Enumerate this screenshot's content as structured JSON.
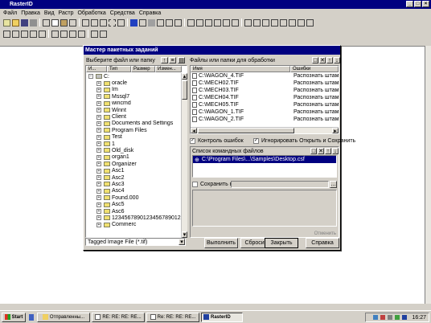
{
  "app": {
    "title": "RasterID",
    "menu": [
      "Файл",
      "Правка",
      "Вид",
      "Растр",
      "Обработка",
      "Средства",
      "Справка"
    ]
  },
  "dialog": {
    "title": "Мастер пакетных заданий",
    "left_panel": {
      "caption": "Выберите файл или папку",
      "columns": [
        "И...",
        "Тип",
        "Размер",
        "Измен..."
      ],
      "tree": [
        "C:",
        "oracle",
        "Im",
        "Mssql7",
        "wincmd",
        "Winnt",
        "Client",
        "Documents and Settings",
        "Program Files",
        "Test",
        "1",
        "Old_disk",
        "organ1",
        "Organizer",
        "Asc1",
        "Asc2",
        "Asc3",
        "Asc4",
        "Found.000",
        "Asc5",
        "Asc6",
        "12345678901234567890123456",
        "Commerc"
      ],
      "filter": "Tagged Image File (*.tif)"
    },
    "right_panel": {
      "caption": "Файлы или папки для обработки",
      "columns": [
        "Имя",
        "Ошибки"
      ],
      "files": [
        {
          "name": "C:\\WAGON_4.TIF",
          "status": "Распознать штамп"
        },
        {
          "name": "C:\\MECH02.TIF",
          "status": "Распознать штамп"
        },
        {
          "name": "C:\\MECH03.TIF",
          "status": "Распознать штамп"
        },
        {
          "name": "C:\\MECH04.TIF",
          "status": "Распознать штамп"
        },
        {
          "name": "C:\\MECH05.TIF",
          "status": "Распознать штамп"
        },
        {
          "name": "C:\\WAGON_1.TIF",
          "status": "Распознать штамп"
        },
        {
          "name": "C:\\WAGON_2.TIF",
          "status": "Распознать штамп"
        }
      ],
      "check_errors": "Контроль ошибок",
      "ignore_open_save": "Игнорировать Открыть и Сохранить",
      "commands_caption": "Список командных файлов",
      "command_item": "C:\\Program Files\\...\\Samples\\Desktop.csf",
      "save_in": "Сохранить в ...",
      "cancel_link": "Отменить"
    },
    "buttons": {
      "run": "Выполнить",
      "reset": "Сбросить",
      "close": "Закрыть",
      "help": "Справка"
    }
  },
  "taskbar": {
    "start": "Start",
    "tasks": [
      "Отправленны...",
      "RE: RE: RE: RE...",
      "Re: RE: RE: RE...",
      "RasterID"
    ],
    "clock": "16:27"
  }
}
